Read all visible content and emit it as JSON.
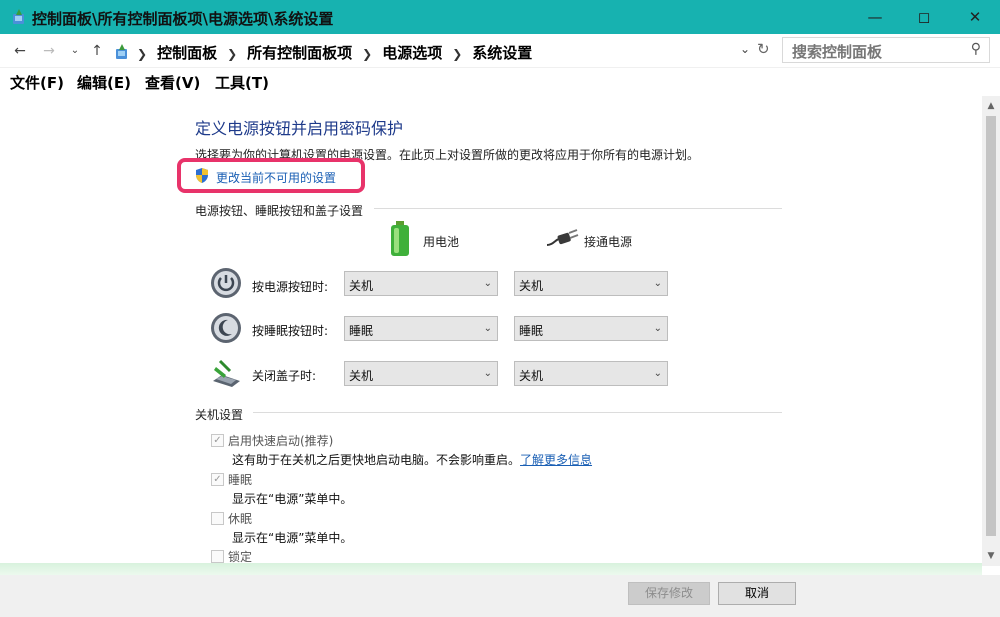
{
  "window": {
    "title": "控制面板\\所有控制面板项\\电源选项\\系统设置"
  },
  "nav": {
    "breadcrumbs": [
      "控制面板",
      "所有控制面板项",
      "电源选项",
      "系统设置"
    ],
    "search_placeholder": "搜索控制面板"
  },
  "menu": [
    "文件(F)",
    "编辑(E)",
    "查看(V)",
    "工具(T)"
  ],
  "page": {
    "title": "定义电源按钮并启用密码保护",
    "description": "选择要为你的计算机设置的电源设置。在此页上对设置所做的更改将应用于你所有的电源计划。",
    "change_link": "更改当前不可用的设置"
  },
  "buttons_section": {
    "heading": "电源按钮、睡眠按钮和盖子设置",
    "col_battery": "用电池",
    "col_plugged": "接通电源",
    "rows": [
      {
        "label": "按电源按钮时:",
        "battery": "关机",
        "plugged": "关机"
      },
      {
        "label": "按睡眠按钮时:",
        "battery": "睡眠",
        "plugged": "睡眠"
      },
      {
        "label": "关闭盖子时:",
        "battery": "关机",
        "plugged": "关机"
      }
    ]
  },
  "shutdown_section": {
    "heading": "关机设置",
    "items": [
      {
        "label": "启用快速启动(推荐)",
        "checked": true,
        "desc": "这有助于在关机之后更快地启动电脑。不会影响重启。",
        "link": "了解更多信息"
      },
      {
        "label": "睡眠",
        "checked": true,
        "desc": "显示在“电源”菜单中。"
      },
      {
        "label": "休眠",
        "checked": false,
        "desc": "显示在“电源”菜单中。"
      },
      {
        "label": "锁定",
        "checked": false
      }
    ]
  },
  "footer": {
    "save": "保存修改",
    "cancel": "取消"
  },
  "colors": {
    "titlebar": "#17b2b0",
    "highlight": "#e8336a",
    "link": "#1a5fb4"
  }
}
